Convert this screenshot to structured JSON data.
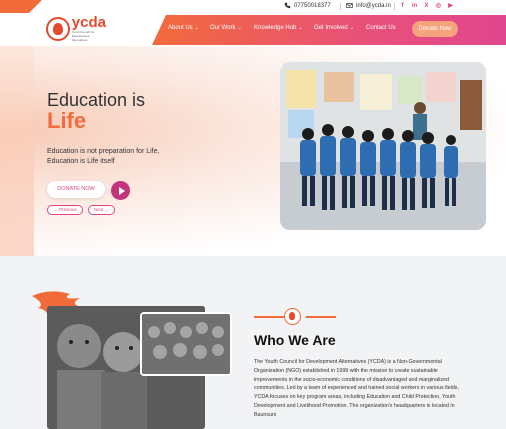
{
  "topbar": {
    "phone": "07750018377",
    "email": "info@ycda.in",
    "social": [
      {
        "name": "facebook-icon",
        "glyph": "f"
      },
      {
        "name": "linkedin-icon",
        "glyph": "in"
      },
      {
        "name": "x-icon",
        "glyph": "X"
      },
      {
        "name": "instagram-icon",
        "glyph": "◎"
      },
      {
        "name": "youtube-icon",
        "glyph": "▶"
      }
    ]
  },
  "header": {
    "logo_text": "ycda",
    "logo_tagline": "Youth Council for Development Alternatives",
    "nav": [
      {
        "label": "About Us",
        "has_caret": true
      },
      {
        "label": "Our Work",
        "has_caret": true
      },
      {
        "label": "Knowledge Hub",
        "has_caret": true
      },
      {
        "label": "Get Involved",
        "has_caret": true
      },
      {
        "label": "Contact Us",
        "has_caret": false
      }
    ],
    "donate_label": "Donate Now"
  },
  "hero": {
    "title_line1": "Education is",
    "title_line2": "Life",
    "subtitle": "Education is not preparation for Life, Education is Life itself",
    "donate_label": "DONATE NOW",
    "prev_label": "← Previous",
    "next_label": "Next →"
  },
  "about": {
    "title": "Who We Are",
    "text": "The Youth Council for Development Alternatives (YCDA) is a Non-Governmental Organization (NGO) established in 1999 with the mission to create sustainable improvements in the socio-economic conditions of disadvantaged and marginalized communities. Led by a team of experienced and trained social workers in various fields, YCDA focuses on key program areas, including Education and Child Protection, Youth Development and Livelihood Promotion. The organization's headquarters is located in Baunsuni"
  },
  "colors": {
    "brand_orange": "#f26b3a",
    "brand_pink": "#e0457b",
    "play_purple": "#c4347e"
  }
}
